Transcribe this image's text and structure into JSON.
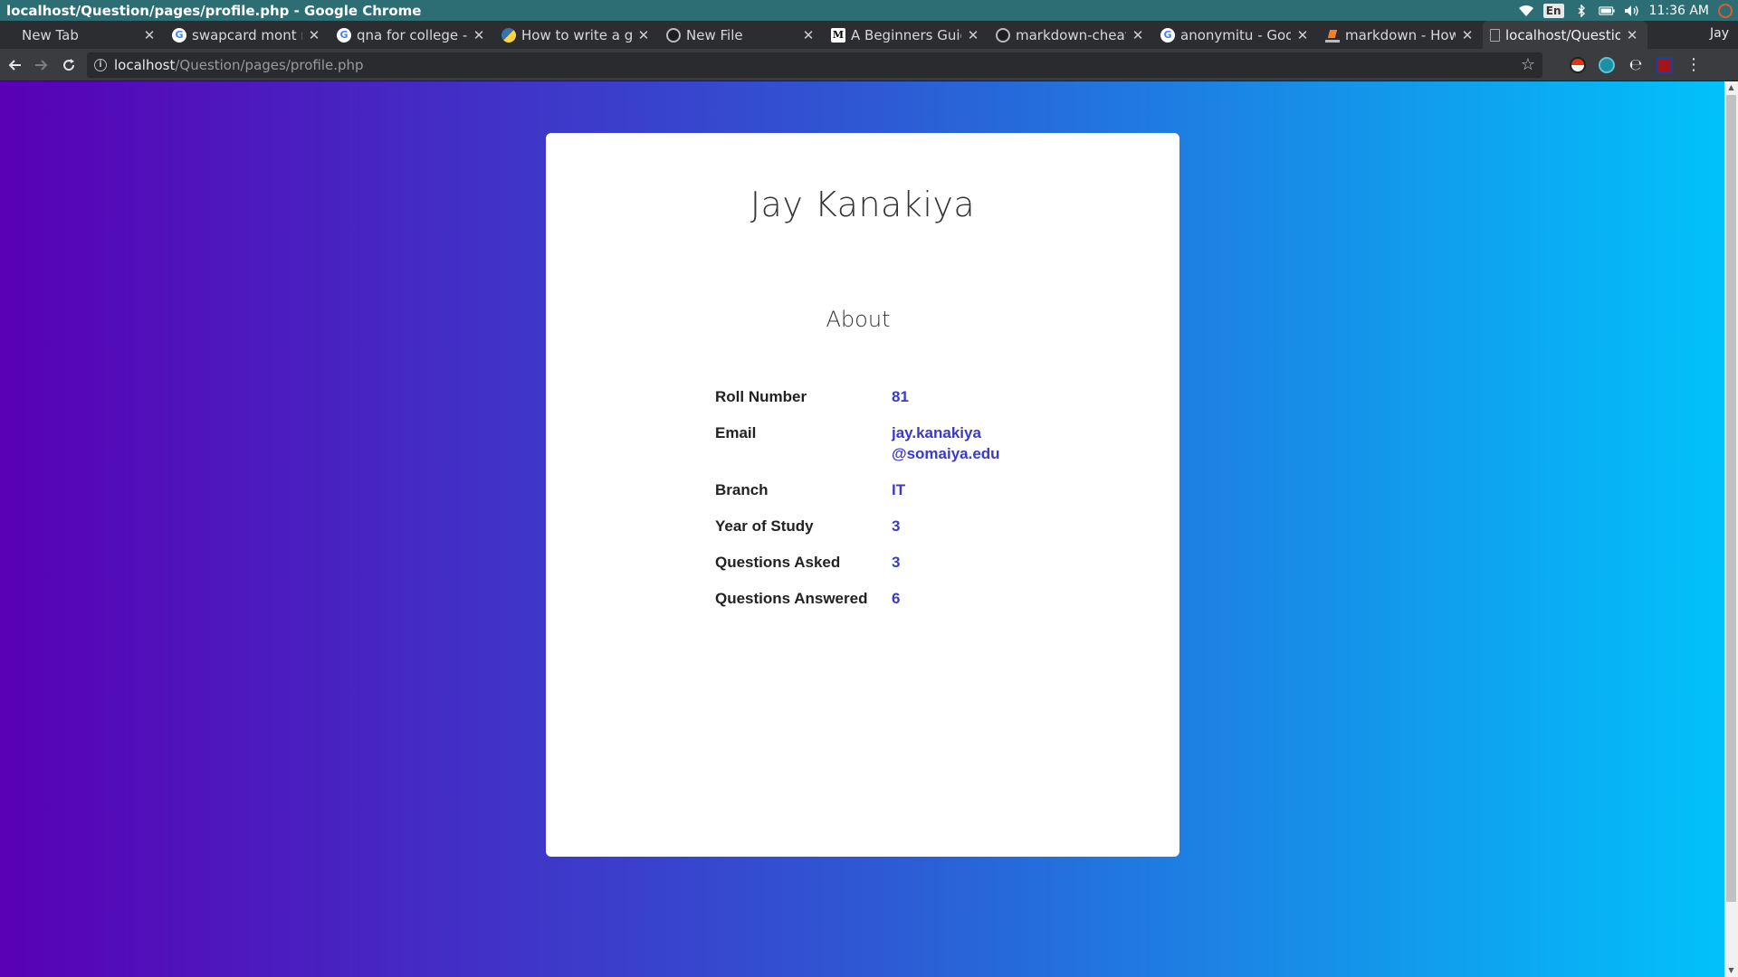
{
  "os": {
    "window_title": "localhost/Question/pages/profile.php - Google Chrome",
    "language": "En",
    "clock": "11:36 AM"
  },
  "browser": {
    "profile_name": "Jay",
    "tabs": [
      {
        "label": "New Tab",
        "icon": "none"
      },
      {
        "label": "swapcard mont re",
        "icon": "google-icon"
      },
      {
        "label": "qna for college - G",
        "icon": "google-icon"
      },
      {
        "label": "How to write a gre",
        "icon": "python-icon"
      },
      {
        "label": "New File",
        "icon": "github-icon"
      },
      {
        "label": "A Beginners Guide",
        "icon": "medium-icon"
      },
      {
        "label": "markdown-cheats",
        "icon": "github-icon"
      },
      {
        "label": "anonymitu - Goog",
        "icon": "google-icon"
      },
      {
        "label": "markdown - How",
        "icon": "stackoverflow-icon"
      },
      {
        "label": "localhost/Questio",
        "icon": "page-icon",
        "active": true
      }
    ],
    "url_host": "localhost",
    "url_path": "/Question/pages/profile.php"
  },
  "profile": {
    "name": "Jay Kanakiya",
    "section_title": "About",
    "fields": {
      "roll_number": {
        "label": "Roll Number",
        "value": "81"
      },
      "email": {
        "label": "Email",
        "value_line1": "jay.kanakiya",
        "value_line2": "@somaiya.edu"
      },
      "branch": {
        "label": "Branch",
        "value": "IT"
      },
      "year": {
        "label": "Year of Study",
        "value": "3"
      },
      "asked": {
        "label": "Questions Asked",
        "value": "3"
      },
      "answered": {
        "label": "Questions Answered",
        "value": "6"
      }
    }
  },
  "colors": {
    "gradient_start": "#5900b5",
    "gradient_end": "#00c3fb",
    "value_text": "#3a3ac7"
  }
}
